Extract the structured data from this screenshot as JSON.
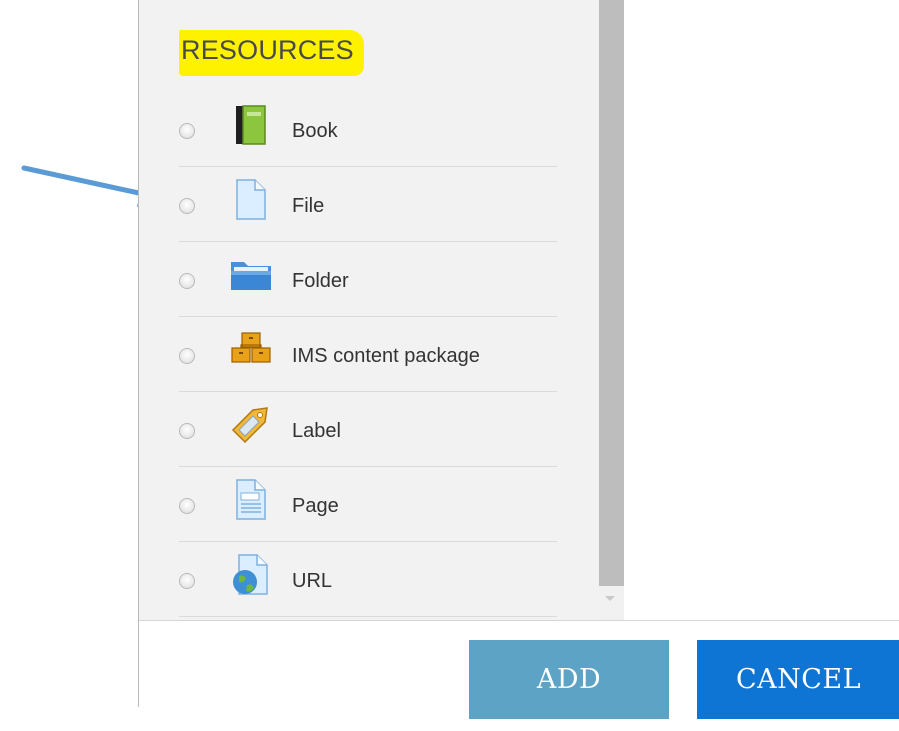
{
  "section": {
    "title": "RESOURCES"
  },
  "items": [
    {
      "label": "Book",
      "icon": "book-icon",
      "selected": false
    },
    {
      "label": "File",
      "icon": "file-icon",
      "selected": false
    },
    {
      "label": "Folder",
      "icon": "folder-icon",
      "selected": false
    },
    {
      "label": "IMS content package",
      "icon": "package-icon",
      "selected": false
    },
    {
      "label": "Label",
      "icon": "label-tag-icon",
      "selected": false
    },
    {
      "label": "Page",
      "icon": "page-icon",
      "selected": false
    },
    {
      "label": "URL",
      "icon": "url-globe-icon",
      "selected": false
    }
  ],
  "footer": {
    "add_label": "ADD",
    "cancel_label": "CANCEL"
  },
  "colors": {
    "highlight": "#fff200",
    "add_button": "#5da3c6",
    "cancel_button": "#0f75d4",
    "annotation_arrow": "#5b9bd5"
  }
}
